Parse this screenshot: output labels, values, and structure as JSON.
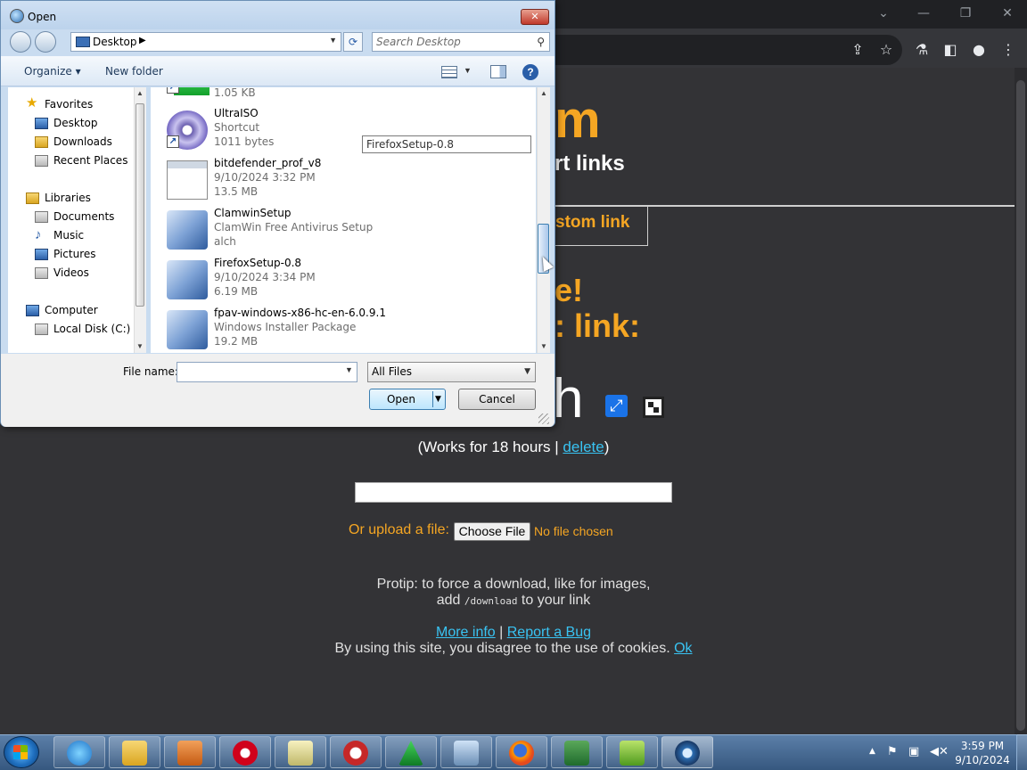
{
  "dialog": {
    "title": "Open",
    "close_label": "✕",
    "address": "Desktop",
    "search_placeholder": "Search Desktop",
    "toolbar": {
      "organize": "Organize ▾",
      "new_folder": "New folder",
      "help": "?"
    },
    "nav": {
      "favorites_header": "Favorites",
      "favorites": [
        "Desktop",
        "Downloads",
        "Recent Places"
      ],
      "libraries_header": "Libraries",
      "libraries": [
        "Documents",
        "Music",
        "Pictures",
        "Videos"
      ],
      "computer_header": "Computer",
      "computer": [
        "Local Disk (C:)"
      ]
    },
    "files": [
      {
        "name": "",
        "line1": "1.05 KB",
        "line2": "",
        "icon": "green-app-icon"
      },
      {
        "name": "UltraISO",
        "line1": "Shortcut",
        "line2": "1011 bytes",
        "icon": "disc-icon"
      },
      {
        "name": "bitdefender_prof_v8",
        "line1": "9/10/2024 3:32 PM",
        "line2": "13.5 MB",
        "icon": "document-icon"
      },
      {
        "name": "ClamwinSetup",
        "line1": "ClamWin Free Antivirus Setup",
        "line2": "alch",
        "icon": "setup-icon"
      },
      {
        "name": "FirefoxSetup-0.8",
        "line1": "9/10/2024 3:34 PM",
        "line2": "6.19 MB",
        "icon": "setup-icon"
      },
      {
        "name": "fpav-windows-x86-hc-en-6.0.9.1",
        "line1": "Windows Installer Package",
        "line2": "19.2 MB",
        "icon": "installer-icon"
      }
    ],
    "tooltip": "FirefoxSetup-0.8",
    "file_name_label": "File name:",
    "file_name_value": "",
    "filter": "All Files",
    "open_label": "Open",
    "cancel_label": "Cancel"
  },
  "page": {
    "logo": "m",
    "tagline": "rt links",
    "custom_link": "stom link",
    "heading1": "e!",
    "heading2": ": link:",
    "big_text": "h",
    "works_prefix": "(Works for 18 hours | ",
    "delete_link": "delete",
    "works_suffix": ")",
    "upload_label": "Or upload a file:",
    "choose_file": "Choose File",
    "no_file": "No file chosen",
    "protip_line1": "Protip: to force a download, like for images,",
    "protip_add": "add ",
    "protip_code": "/download",
    "protip_end": " to your link",
    "more_info": "More info",
    "separator": " | ",
    "report_bug": "Report a Bug",
    "cookie_text": "By using this site, you disagree to the use of cookies. ",
    "ok_link": "Ok"
  },
  "taskbar": {
    "apps": [
      "internet-explorer-icon",
      "file-explorer-icon",
      "media-player-icon",
      "opera-icon",
      "notepad-chart-icon",
      "hijackthis-icon",
      "avast-triangle-icon",
      "network-computer-icon",
      "firefox-icon",
      "kaspersky-icon",
      "installer-box-icon",
      "clamwin-globe-icon"
    ],
    "time": "3:59 PM",
    "date": "9/10/2024"
  },
  "colors": {
    "accent": "#f5a623",
    "link": "#39c3f2",
    "page_bg": "#333336"
  }
}
